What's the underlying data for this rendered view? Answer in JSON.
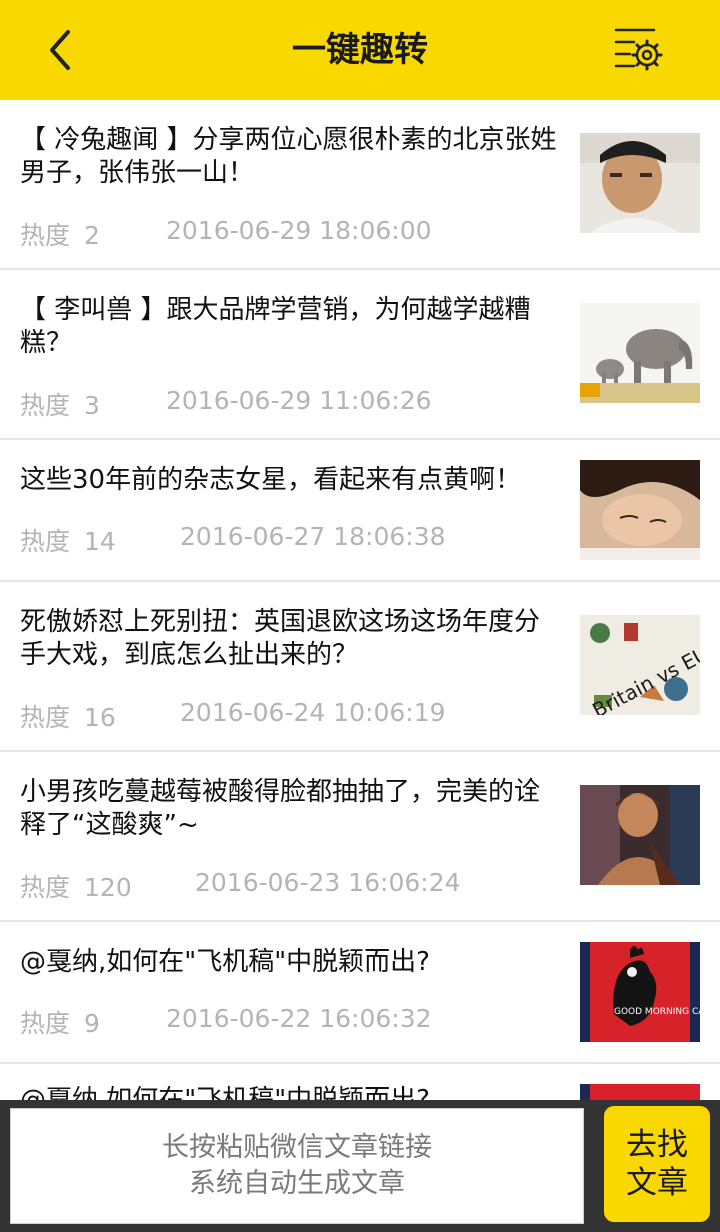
{
  "header": {
    "title": "一键趣转",
    "back_icon": "chevron-left-icon",
    "settings_icon": "list-settings-icon"
  },
  "colors": {
    "accent": "#f9d800",
    "bottom_bar": "#333333",
    "meta_text": "#b4b4b4"
  },
  "articles": [
    {
      "title": "【 冷兔趣闻 】分享两位心愿很朴素的北京张姓男子，张伟张一山！",
      "heat_label": "热度",
      "heat": "2",
      "date": "2016-06-29 18:06:00",
      "thumb": "young-man-portrait"
    },
    {
      "title": "【 李叫兽 】跟大品牌学营销，为何越学越糟糕？",
      "heat_label": "热度",
      "heat": "3",
      "date": "2016-06-29 11:06:26",
      "thumb": "elephants"
    },
    {
      "title": "这些30年前的杂志女星，看起来有点黄啊！",
      "heat_label": "热度",
      "heat": "14",
      "date": "2016-06-27 18:06:38",
      "thumb": "woman-portrait"
    },
    {
      "title": "死傲娇怼上死别扭：英国退欧这场这场年度分手大戏，到底怎么扯出来的？",
      "heat_label": "热度",
      "heat": "16",
      "date": "2016-06-24 10:06:19",
      "thumb": "britain-vs-eu",
      "thumb_text": "Britain vs EU"
    },
    {
      "title": "小男孩吃蔓越莓被酸得脸都抽抽了，完美的诠释了“这酸爽”~",
      "heat_label": "热度",
      "heat": "120",
      "date": "2016-06-23 16:06:24",
      "thumb": "boy-photo"
    },
    {
      "title": "@戛纳,如何在\"飞机稿\"中脱颖而出?",
      "heat_label": "热度",
      "heat": "9",
      "date": "2016-06-22 16:06:32",
      "thumb": "rooster-poster",
      "thumb_text": "GOOD MORNING CANNES"
    },
    {
      "title": "@戛纳,如何在\"飞机稿\"中脱颖而出?",
      "thumb": "red-poster"
    }
  ],
  "bottom": {
    "paste_line1": "长按粘贴微信文章链接",
    "paste_line2": "系统自动生成文章",
    "find_line1": "去找",
    "find_line2": "文章"
  }
}
